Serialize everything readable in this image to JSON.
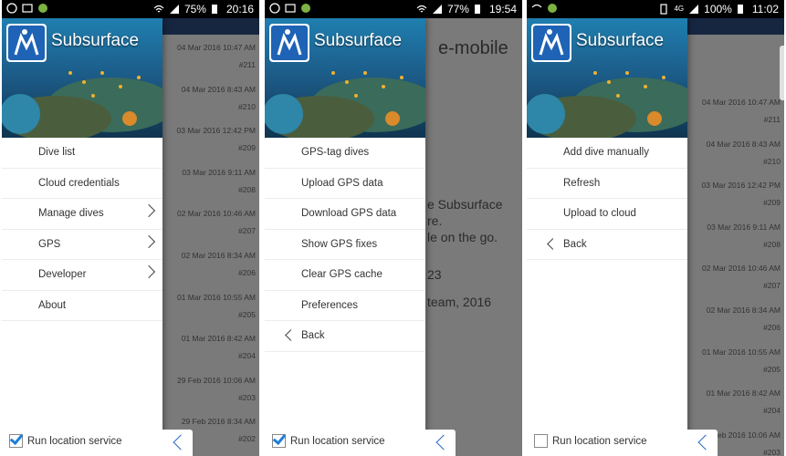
{
  "brand": "Subsurface",
  "phone1": {
    "status": {
      "battery": "75%",
      "time": "20:16"
    },
    "menu": [
      {
        "label": "Dive list"
      },
      {
        "label": "Cloud credentials"
      },
      {
        "label": "Manage dives"
      },
      {
        "label": "GPS"
      },
      {
        "label": "Developer"
      },
      {
        "label": "About"
      }
    ],
    "location_label": "Run location service",
    "location_checked": true,
    "background_dives": [
      {
        "date": "04 Mar 2016 10:47 AM",
        "num": "#211"
      },
      {
        "date": "04 Mar 2016 8:43 AM",
        "num": "#210"
      },
      {
        "date": "03 Mar 2016 12:42 PM",
        "num": "#209"
      },
      {
        "date": "03 Mar 2016 9:11 AM",
        "num": "#208"
      },
      {
        "date": "02 Mar 2016 10:46 AM",
        "num": "#207"
      },
      {
        "date": "02 Mar 2016 8:34 AM",
        "num": "#206"
      },
      {
        "date": "01 Mar 2016 10:55 AM",
        "num": "#205"
      },
      {
        "date": "01 Mar 2016 8:42 AM",
        "num": "#204"
      },
      {
        "date": "29 Feb 2016 10:06 AM",
        "num": "#203"
      },
      {
        "date": "29 Feb 2016 8:34 AM",
        "num": "#202"
      }
    ]
  },
  "phone2": {
    "status": {
      "battery": "77%",
      "time": "19:54"
    },
    "menu": [
      {
        "label": "GPS-tag dives"
      },
      {
        "label": "Upload GPS data"
      },
      {
        "label": "Download GPS data"
      },
      {
        "label": "Show GPS fixes"
      },
      {
        "label": "Clear GPS cache"
      },
      {
        "label": "Preferences"
      },
      {
        "label": "Back"
      }
    ],
    "location_label": "Run location service",
    "location_checked": true,
    "background": {
      "title": "e-mobile",
      "lines": [
        "e Subsurface",
        "re.",
        "le on the go.",
        "23",
        "team, 2016"
      ]
    }
  },
  "phone3": {
    "status": {
      "network": "4G",
      "battery": "100%",
      "time": "11:02"
    },
    "menu": [
      {
        "label": "Add dive manually"
      },
      {
        "label": "Refresh"
      },
      {
        "label": "Upload to cloud"
      },
      {
        "label": "Back"
      }
    ],
    "location_label": "Run location service",
    "location_checked": false,
    "background_dives": [
      {
        "date": "04 Mar 2016 10:47 AM",
        "num": "#211"
      },
      {
        "date": "04 Mar 2016 8:43 AM",
        "num": "#210"
      },
      {
        "date": "03 Mar 2016 12:42 PM",
        "num": "#209"
      },
      {
        "date": "03 Mar 2016 9:11 AM",
        "num": "#208"
      },
      {
        "date": "02 Mar 2016 10:46 AM",
        "num": "#207"
      },
      {
        "date": "02 Mar 2016 8:34 AM",
        "num": "#206"
      },
      {
        "date": "01 Mar 2016 10:55 AM",
        "num": "#205"
      },
      {
        "date": "01 Mar 2016 8:42 AM",
        "num": "#204"
      },
      {
        "date": "29 Feb 2016 10:06 AM",
        "num": "#203"
      }
    ]
  },
  "colors": {
    "appbar": "#2c4d82",
    "accent": "#2a6cc4",
    "drawer": "#ffffff"
  }
}
